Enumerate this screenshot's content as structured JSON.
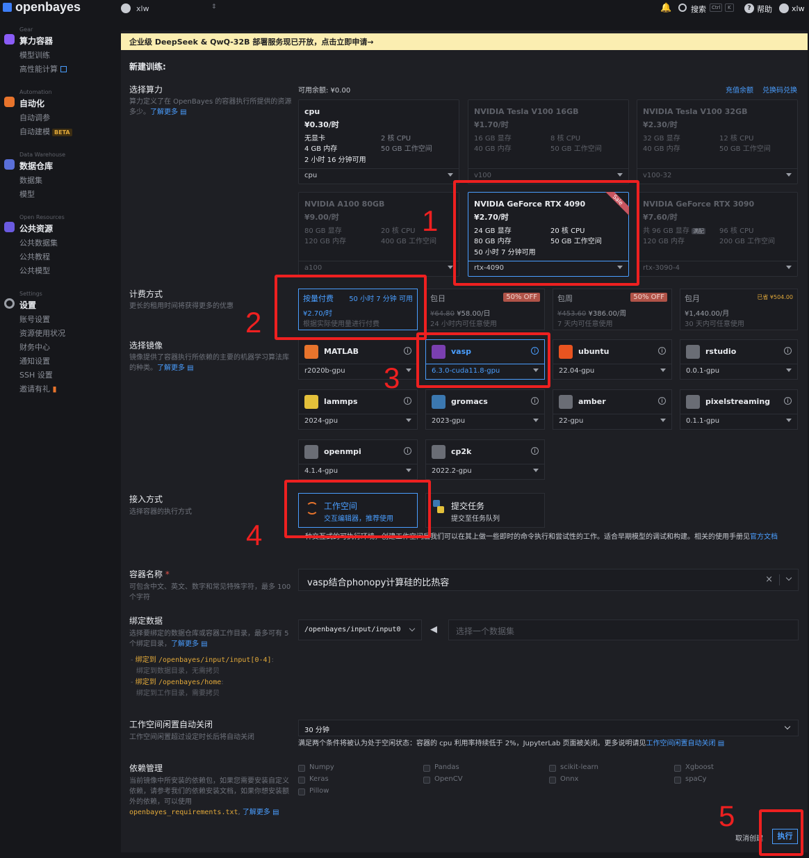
{
  "topbar": {
    "brand": "openbayes",
    "user": "xlw",
    "search": "搜索",
    "kbd_ctrl": "Ctrl",
    "kbd_k": "K",
    "help": "帮助",
    "user_right": "xlw"
  },
  "sidebar": {
    "groups": [
      {
        "en": "Gear",
        "title": "算力容器",
        "items": [
          "模型训练",
          "高性能计算"
        ]
      },
      {
        "en": "Automation",
        "title": "自动化",
        "items": [
          "自动调参",
          "自动建模"
        ],
        "badge": "BETA"
      },
      {
        "en": "Data Warehouse",
        "title": "数据仓库",
        "items": [
          "数据集",
          "模型"
        ]
      },
      {
        "en": "Open Resources",
        "title": "公共资源",
        "items": [
          "公共数据集",
          "公共教程",
          "公共模型"
        ]
      },
      {
        "en": "Settings",
        "title": "设置",
        "items": [
          "账号设置",
          "资源使用状况",
          "财务中心",
          "通知设置",
          "SSH 设置",
          "邀请有礼"
        ]
      }
    ]
  },
  "banner": "企业级 DeepSeek & QwQ-32B 部署服务现已开放，点击立即申请→",
  "page_title": "新建训练:",
  "compute": {
    "title": "选择算力",
    "desc": "算力定义了在 OpenBayes 的容器执行所提供的资源多少。",
    "learn_more": "了解更多",
    "balance": "可用余额: ¥0.00",
    "recharge": "充值余额",
    "redeem": "兑换码兑换",
    "cards": [
      {
        "name": "cpu",
        "price": "¥0.30/时",
        "s1": "无显卡",
        "s2": "2 核 CPU",
        "s3": "4 GB 内存",
        "s4": "50 GB 工作空间",
        "avail": "2 小时 16 分钟可用",
        "select": "cpu"
      },
      {
        "name": "NVIDIA Tesla V100 16GB",
        "price": "¥1.70/时",
        "s1": "16 GB 显存",
        "s2": "8 核 CPU",
        "s3": "40 GB 内存",
        "s4": "50 GB 工作空间",
        "select": "v100"
      },
      {
        "name": "NVIDIA Tesla V100 32GB",
        "price": "¥2.30/时",
        "s1": "32 GB 显存",
        "s2": "12 核 CPU",
        "s3": "40 GB 内存",
        "s4": "50 GB 工作空间",
        "select": "v100-32"
      },
      {
        "name": "NVIDIA A100 80GB",
        "price": "¥9.00/时",
        "s1": "80 GB 显存",
        "s2": "20 核 CPU",
        "s3": "120 GB 内存",
        "s4": "400 GB 工作空间",
        "select": "a100"
      },
      {
        "name": "NVIDIA GeForce RTX 4090",
        "price": "¥2.70/时",
        "s1": "24 GB 显存",
        "s2": "20 核 CPU",
        "s3": "80 GB 内存",
        "s4": "50 GB 工作空间",
        "avail": "50 小时 7 分钟可用",
        "select": "rtx-4090",
        "sale": "Sale"
      },
      {
        "name": "NVIDIA GeForce RTX 3090",
        "price": "¥7.60/时",
        "s1": "共 96 GB 显存",
        "s1b": "满配",
        "s2": "96 核 CPU",
        "s3": "120 GB 内存",
        "s4": "200 GB 工作空间",
        "select": "rtx-3090-4"
      }
    ]
  },
  "billing": {
    "title": "计费方式",
    "desc": "更长的租用时间将获得更多的优惠",
    "cards": [
      {
        "name": "按量付费",
        "extra": "50 小时 7 分钟 可用",
        "price": "¥2.70/时",
        "note": "根据实际使用量进行付费"
      },
      {
        "name": "包日",
        "off": "50% OFF",
        "old": "¥64.80",
        "price": "¥58.00/日",
        "note": "24 小时内可任意使用"
      },
      {
        "name": "包周",
        "off": "50% OFF",
        "old": "¥453.60",
        "price": "¥386.00/周",
        "note": "7 天内可任意使用"
      },
      {
        "name": "包月",
        "saved": "已省 ¥504.00",
        "price": "¥1,440.00/月",
        "note": "30 天内可任意使用"
      }
    ]
  },
  "image": {
    "title": "选择镜像",
    "desc": "镜像提供了容器执行所依赖的主要的机器学习算法库的种类。",
    "learn_more": "了解更多",
    "cards": [
      {
        "name": "MATLAB",
        "ver": "r2020b-gpu",
        "icon": "matlab-icon"
      },
      {
        "name": "vasp",
        "ver": "6.3.0-cuda11.8-gpu",
        "icon": "vasp-icon"
      },
      {
        "name": "ubuntu",
        "ver": "22.04-gpu",
        "icon": "ubuntu-icon"
      },
      {
        "name": "rstudio",
        "ver": "0.0.1-gpu",
        "icon": "rstudio-icon"
      },
      {
        "name": "lammps",
        "ver": "2024-gpu",
        "icon": "lammps-icon"
      },
      {
        "name": "gromacs",
        "ver": "2023-gpu",
        "icon": "gromacs-icon"
      },
      {
        "name": "amber",
        "ver": "22-gpu",
        "icon": "amber-icon"
      },
      {
        "name": "pixelstreaming",
        "ver": "0.1.1-gpu",
        "icon": "pixelstreaming-icon"
      },
      {
        "name": "openmpi",
        "ver": "4.1.4-gpu",
        "icon": "openmpi-icon"
      },
      {
        "name": "cp2k",
        "ver": "2022.2-gpu",
        "icon": "cp2k-icon"
      }
    ]
  },
  "access": {
    "title": "接入方式",
    "desc": "选择容器的执行方式",
    "opt1_title": "工作空间",
    "opt1_sub": "交互编辑器，推荐使用",
    "opt2_title": "提交任务",
    "opt2_sub": "提交至任务队列",
    "note": "一种交互式的可执行环境，创建工作空间后我们可以在其上做一些即时的命令执行和尝试性的工作。适合早期模型的调试和构建。相关的使用手册见",
    "note_link1": "官方",
    "note_link2": "文档"
  },
  "container": {
    "title": "容器名称",
    "required": "*",
    "desc": "可包含中文、英文、数字和常见特殊字符，最多 100 个字符",
    "value": "vasp结合phonopy计算硅的比热容",
    "clear": "×"
  },
  "bind": {
    "title": "绑定数据",
    "desc": "选择要绑定的数据仓库或容器工作目录，最多可有 5 个绑定目录，",
    "learn_more": "了解更多",
    "b1_label": "绑定到",
    "b1_path": "/openbayes/input/input[0-4]",
    "b1_note": "绑定到数据目录，无需拷贝",
    "b2_label": "绑定到",
    "b2_path": "/openbayes/home",
    "b2_note": "绑定到工作目录，需要拷贝",
    "select_value": "/openbayes/input/input0",
    "dataset_placeholder": "选择一个数据集"
  },
  "idle": {
    "title": "工作空间闲置自动关闭",
    "desc": "工作空间闲置超过设定时长后将自动关闭",
    "value": "30 分钟",
    "note": "满足两个条件将被认为处于空闲状态：容器的 cpu 利用率持续低于 2%，JupyterLab 页面被关闭。更多说明请见",
    "note_link": "工作空间闲置自动关闭"
  },
  "deps": {
    "title": "依赖管理",
    "desc": "当前镜像中所安装的依赖包，如果您需要安装自定义依赖，请参考我们的依赖安装文档，如果你想安装额外的依赖，可以使用",
    "file": "openbayes_requirements.txt",
    "learn_more": "了解更多",
    "packages": [
      "Numpy",
      "Pandas",
      "scikit-learn",
      "Xgboost",
      "Keras",
      "OpenCV",
      "Onnx",
      "spaCy",
      "Pillow"
    ]
  },
  "footer": {
    "cancel": "取消创建",
    "execute": "执行"
  },
  "annotations": [
    "1",
    "2",
    "3",
    "4",
    "5"
  ],
  "colors": {
    "accent": "#4a9eff",
    "annotation": "#ee2020",
    "banner": "#fbeeb1"
  }
}
